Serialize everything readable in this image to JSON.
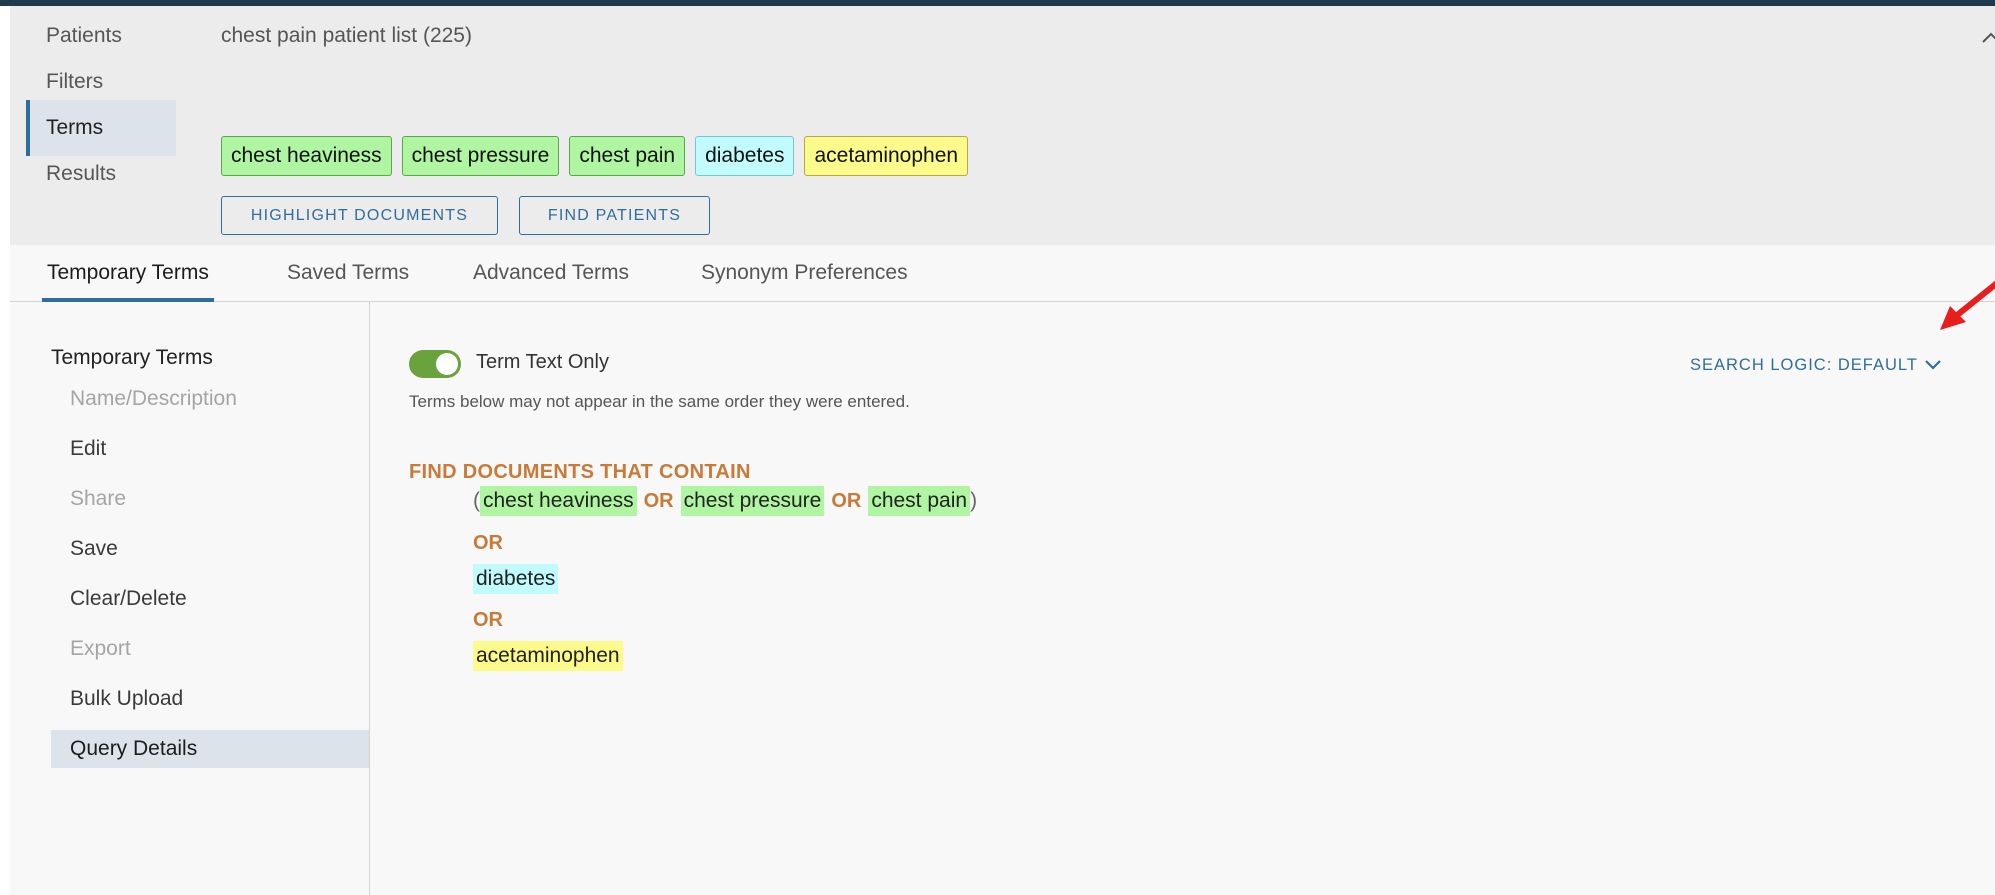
{
  "header": {
    "nav": [
      "Patients",
      "Filters",
      "Terms",
      "Results"
    ],
    "active_nav": "Terms",
    "list_title": "chest pain patient list (225)"
  },
  "terms": [
    {
      "label": "chest heaviness",
      "color": "#b0f5a2"
    },
    {
      "label": "chest pressure",
      "color": "#b0f5a2"
    },
    {
      "label": "chest pain",
      "color": "#b0f5a2"
    },
    {
      "label": "diabetes",
      "color": "#c2fbfd"
    },
    {
      "label": "acetaminophen",
      "color": "#fbfa8a"
    }
  ],
  "actions": {
    "highlight": "HIGHLIGHT DOCUMENTS",
    "find": "FIND PATIENTS"
  },
  "tabs": [
    "Temporary Terms",
    "Saved Terms",
    "Advanced Terms",
    "Synonym Preferences"
  ],
  "active_tab": "Temporary Terms",
  "sidemenu": {
    "title": "Temporary Terms",
    "items": [
      {
        "label": "Name/Description",
        "state": "disabled"
      },
      {
        "label": "Edit",
        "state": "enabled"
      },
      {
        "label": "Share",
        "state": "disabled"
      },
      {
        "label": "Save",
        "state": "enabled"
      },
      {
        "label": "Clear/Delete",
        "state": "enabled"
      },
      {
        "label": "Export",
        "state": "disabled"
      },
      {
        "label": "Bulk Upload",
        "state": "enabled"
      },
      {
        "label": "Query Details",
        "state": "active"
      }
    ]
  },
  "main": {
    "toggle_label": "Term Text Only",
    "toggle_on": true,
    "note": "Terms below may not appear in the same order they were entered.",
    "search_logic": "SEARCH LOGIC: DEFAULT",
    "query_heading": "FIND DOCUMENTS THAT CONTAIN",
    "operator": "OR",
    "open_paren": "(",
    "close_paren": ")"
  },
  "colors": {
    "accent": "#2f6e9c",
    "operator": "#c87a38",
    "toggle": "#6aa33e",
    "annotation_arrow": "#e81e1e"
  }
}
